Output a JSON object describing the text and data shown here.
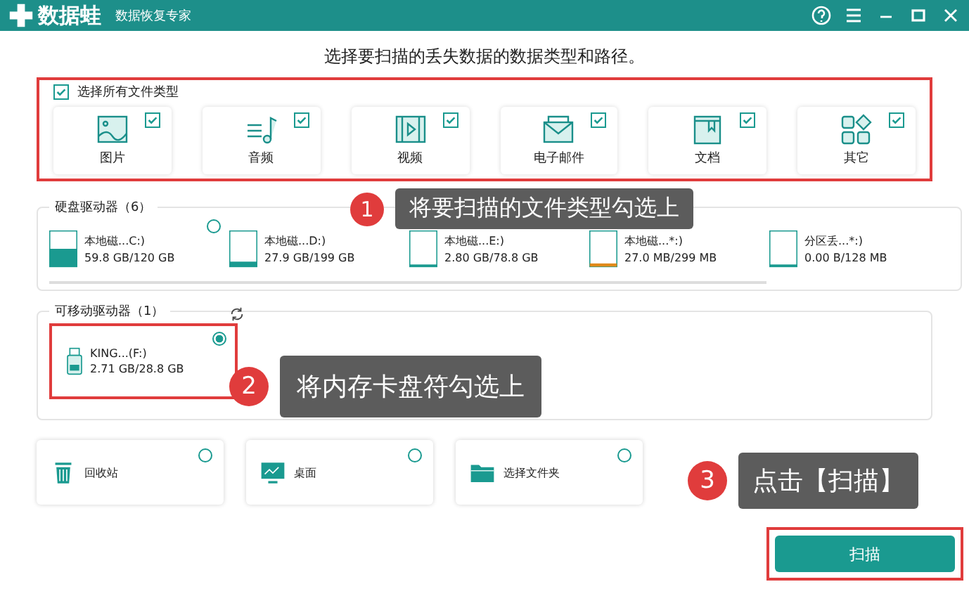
{
  "window": {
    "app_name": "数据蛙",
    "subtitle": "数据恢复专家"
  },
  "heading": "选择要扫描的丢失数据的数据类型和路径。",
  "file_types": {
    "select_all": {
      "label": "选择所有文件类型",
      "checked": true
    },
    "items": [
      {
        "kind": "image",
        "label": "图片",
        "checked": true
      },
      {
        "kind": "audio",
        "label": "音频",
        "checked": true
      },
      {
        "kind": "video",
        "label": "视频",
        "checked": true
      },
      {
        "kind": "email",
        "label": "电子邮件",
        "checked": true
      },
      {
        "kind": "document",
        "label": "文档",
        "checked": true
      },
      {
        "kind": "other",
        "label": "其它",
        "checked": true
      }
    ]
  },
  "hard_drives": {
    "title": "硬盘驱动器（6）",
    "items": [
      {
        "name": "本地磁...C:)",
        "usage": "59.8 GB/120 GB",
        "level": 0.5,
        "color": "#1a9a90",
        "selected": false
      },
      {
        "name": "本地磁...D:)",
        "usage": "27.9 GB/199 GB",
        "level": 0.14,
        "color": "#1a9a90"
      },
      {
        "name": "本地磁...E:)",
        "usage": "2.80 GB/78.8 GB",
        "level": 0.04,
        "color": "#1a9a90"
      },
      {
        "name": "本地磁...*:)",
        "usage": "27.0 MB/299 MB",
        "level": 0.09,
        "color": "#e08a1a"
      },
      {
        "name": "分区丢...*:)",
        "usage": "0.00  B/128 MB",
        "level": 0,
        "color": "#1a9a90"
      }
    ]
  },
  "removable": {
    "title": "可移动驱动器（1）",
    "items": [
      {
        "name": "KING...(F:)",
        "usage": "2.71 GB/28.8 GB",
        "selected": true
      }
    ]
  },
  "locations": [
    {
      "kind": "recycle",
      "label": "回收站",
      "selected": false
    },
    {
      "kind": "desktop",
      "label": "桌面",
      "selected": false
    },
    {
      "kind": "folder",
      "label": "选择文件夹",
      "selected": false
    }
  ],
  "scan_button": "扫描",
  "callouts": [
    {
      "number": "1",
      "text": "将要扫描的文件类型勾选上"
    },
    {
      "number": "2",
      "text": "将内存卡盘符勾选上"
    },
    {
      "number": "3",
      "text": "点击【扫描】"
    }
  ]
}
